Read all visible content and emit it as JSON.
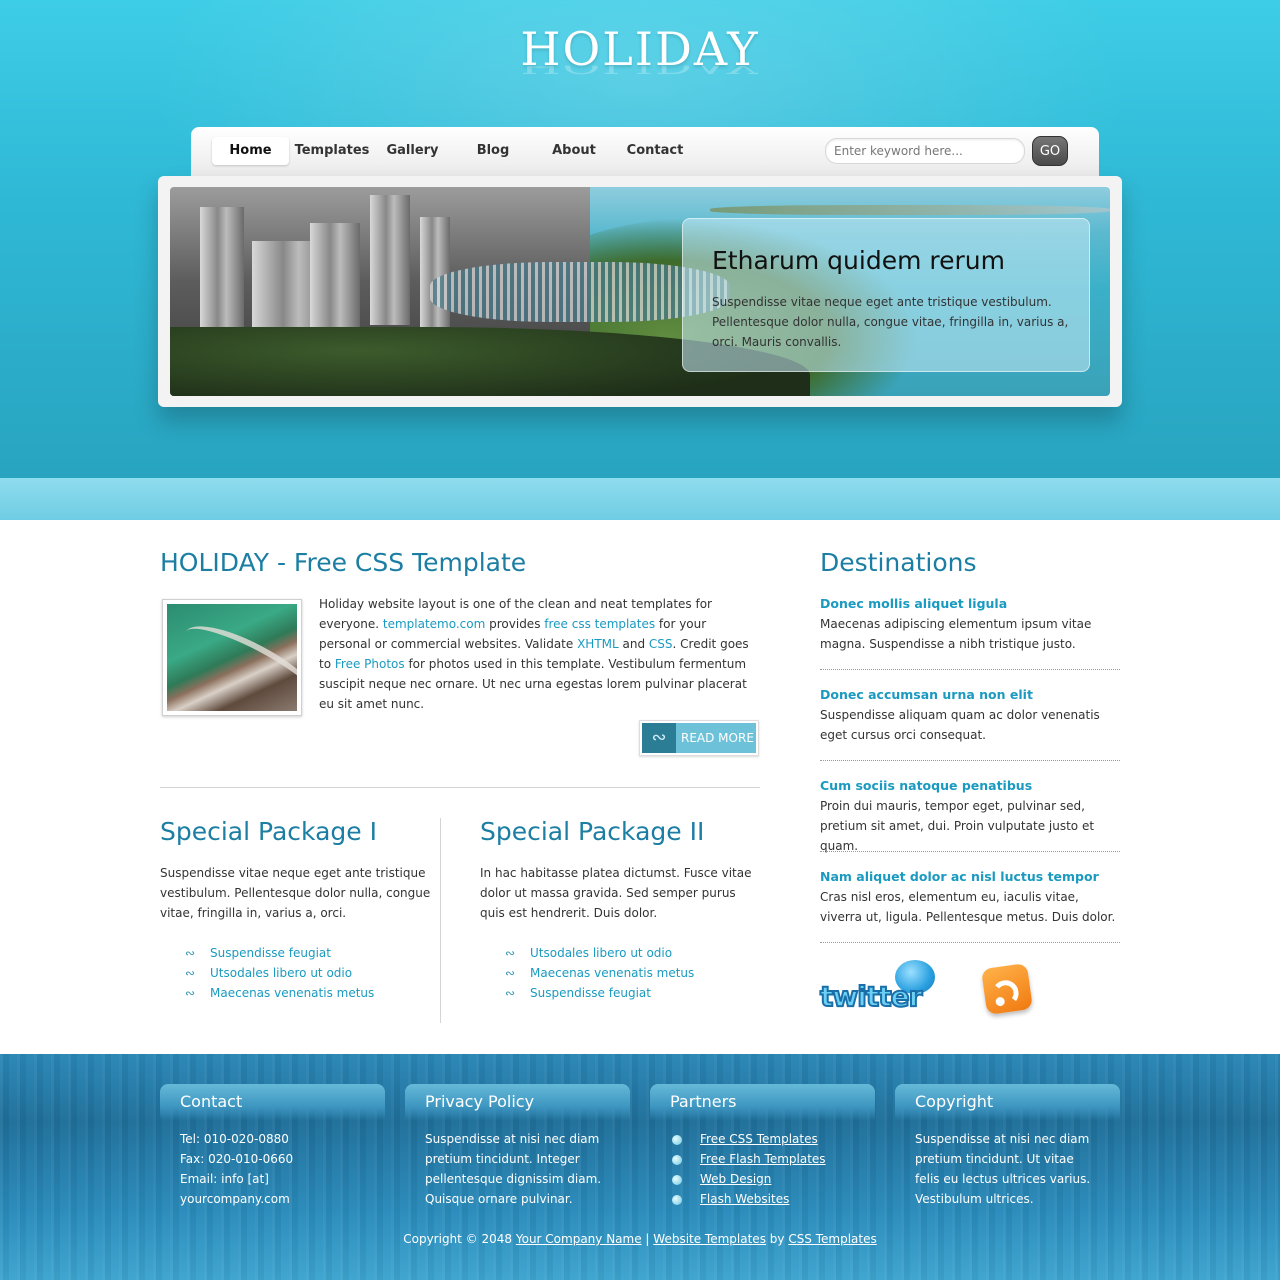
{
  "brand": {
    "logo": "HOLIDAY"
  },
  "nav": {
    "items": [
      "Home",
      "Templates",
      "Gallery",
      "Blog",
      "About",
      "Contact"
    ],
    "active": "Home"
  },
  "search": {
    "placeholder": "Enter keyword here...",
    "button": "GO"
  },
  "slider": {
    "title": "Etharum quidem rerum",
    "text": "Suspendisse vitae neque eget ante tristique vestibulum. Pellentesque dolor nulla, congue vitae, fringilla in, varius a, orci. Mauris convallis."
  },
  "intro": {
    "title": "HOLIDAY - Free CSS Template",
    "p1": "Holiday website layout is one of the clean and neat templates for everyone.",
    "link1": "templatemo.com",
    "p2": " provides ",
    "link2": "free css templates",
    "p3": " for your personal or commercial websites. Validate ",
    "link3": "XHTML",
    "p4": " and ",
    "link4": "CSS",
    "p5": ". Credit goes to ",
    "link5": "Free Photos",
    "p6": " for photos used in this template. Vestibulum fermentum suscipit neque nec ornare. Ut nec urna egestas lorem pulvinar placerat eu sit amet nunc.",
    "read_more": "READ MORE"
  },
  "packages": [
    {
      "title": "Special Package I",
      "text": "Suspendisse vitae neque eget ante tristique vestibulum. Pellentesque dolor nulla, congue vitae, fringilla in, varius a, orci.",
      "items": [
        "Suspendisse feugiat",
        "Utsodales libero ut odio",
        "Maecenas venenatis metus"
      ]
    },
    {
      "title": "Special Package II",
      "text": "In hac habitasse platea dictumst. Fusce vitae dolor ut massa gravida. Sed semper purus quis est hendrerit. Duis dolor.",
      "items": [
        "Utsodales libero ut odio",
        "Maecenas venenatis metus",
        "Suspendisse feugiat"
      ]
    }
  ],
  "destinations": {
    "title": "Destinations",
    "items": [
      {
        "heading": "Donec mollis aliquet ligula",
        "text": "Maecenas adipiscing elementum ipsum vitae magna. Suspendisse a nibh tristique justo."
      },
      {
        "heading": "Donec accumsan urna non elit",
        "text": "Suspendisse aliquam quam ac dolor venenatis eget cursus orci consequat."
      },
      {
        "heading": "Cum sociis natoque penatibus",
        "text": "Proin dui mauris, tempor eget, pulvinar sed, pretium sit amet, dui. Proin vulputate justo et quam."
      },
      {
        "heading": "Nam aliquet dolor ac nisl luctus tempor",
        "text": "Cras nisl eros, elementum eu, iaculis vitae, viverra ut, ligula. Pellentesque metus. Duis dolor."
      }
    ],
    "twitter": "twitter"
  },
  "footer": {
    "contact": {
      "title": "Contact",
      "lines": [
        "Tel: 010-020-0880",
        "Fax: 020-010-0660",
        "Email: info [at] yourcompany.com"
      ]
    },
    "privacy": {
      "title": "Privacy Policy",
      "text": "Suspendisse at nisi nec diam pretium tincidunt. Integer pellentesque dignissim diam. Quisque ornare pulvinar."
    },
    "partners": {
      "title": "Partners",
      "links": [
        "Free CSS Templates",
        "Free Flash Templates",
        "Web Design",
        "Flash Websites"
      ]
    },
    "copyright_col": {
      "title": "Copyright",
      "text": "Suspendisse at nisi nec diam pretium tincidunt. Ut vitae felis eu lectus ultrices varius. Vestibulum ultrices."
    },
    "bottom": {
      "prefix": "Copyright © 2048 ",
      "company": "Your Company Name",
      "sep": " | ",
      "templates": "Website Templates",
      "by": " by ",
      "css": "CSS Templates"
    }
  },
  "colors": {
    "header": "#2fb9d6",
    "accent": "#1b7ea2",
    "link": "#1a9ac0",
    "footer": "#1f6f9a"
  }
}
